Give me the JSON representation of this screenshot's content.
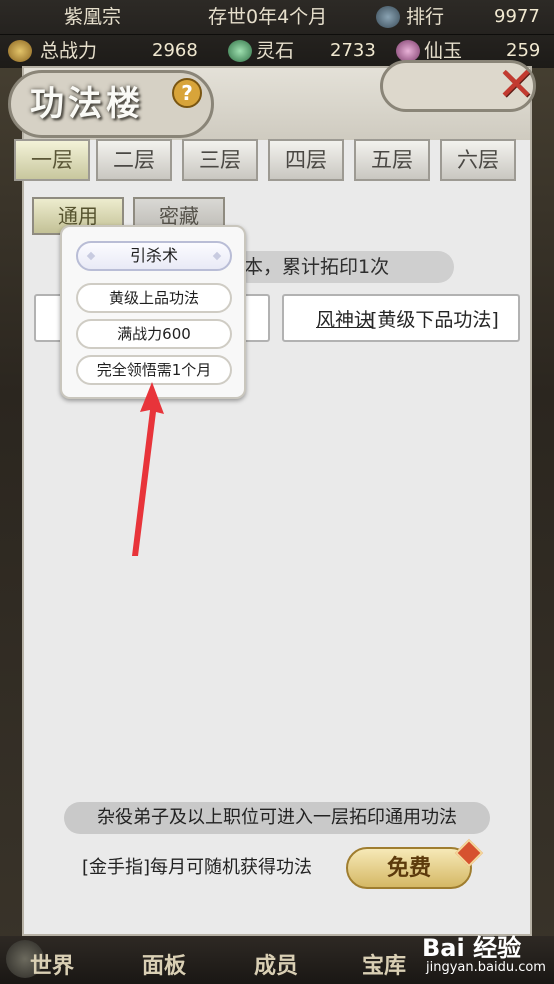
{
  "topbar": {
    "sect_name": "紫凰宗",
    "world_time": "存世0年4个月",
    "rank_label": "排行",
    "rank_value": "9977",
    "combat_label": "总战力",
    "combat_value": "2968",
    "spirit_stone_label": "灵石",
    "spirit_stone_value": "2733",
    "immortal_jade_label": "仙玉",
    "immortal_jade_value": "259"
  },
  "panel": {
    "title": "功法楼",
    "help_symbol": "?",
    "close_symbol": "✕",
    "floor_tabs": [
      {
        "label": "一层"
      },
      {
        "label": "二层"
      },
      {
        "label": "三层"
      },
      {
        "label": "四层"
      },
      {
        "label": "五层"
      },
      {
        "label": "六层"
      }
    ],
    "sub_tabs": [
      {
        "label": "通用"
      },
      {
        "label": "密藏"
      }
    ],
    "info_banner": "本，累计拓印1次",
    "skill_card": {
      "name": "风神诀",
      "grade": "[黄级下品功法]"
    },
    "tooltip": {
      "skill_name": "引杀术",
      "grade": "黄级上品功法",
      "combat_power": "满战力600",
      "mastery_time": "完全领悟需1个月"
    },
    "requirement": "杂役弟子及以上职位可进入一层拓印通用功法",
    "monthly_text": "[金手指]每月可随机获得功法",
    "free_button": "免费"
  },
  "bottom_nav": {
    "items": [
      "世界",
      "面板",
      "成员",
      "宝库"
    ]
  },
  "watermark": {
    "logo": "Bai 经验",
    "url": "jingyan.baidu.com"
  },
  "colors": {
    "arrow": "#e8343a",
    "panel_bg": "#eaeaea",
    "active_tab": "#c8c79e",
    "free_button": "#d5b865"
  }
}
